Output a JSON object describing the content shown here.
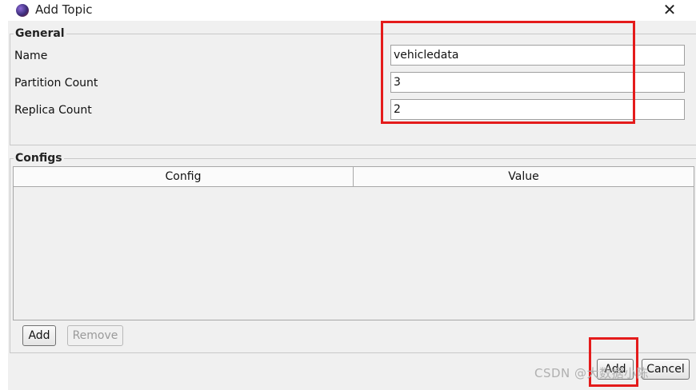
{
  "window": {
    "title": "Add Topic",
    "close_glyph": "✕",
    "icon": "app-icon"
  },
  "general": {
    "legend": "General",
    "fields": [
      {
        "label": "Name",
        "value": "vehicledata"
      },
      {
        "label": "Partition Count",
        "value": "3"
      },
      {
        "label": "Replica Count",
        "value": "2"
      }
    ]
  },
  "configs": {
    "legend": "Configs",
    "columns": [
      "Config",
      "Value"
    ],
    "rows": [],
    "add_label": "Add",
    "remove_label": "Remove"
  },
  "footer": {
    "add_label": "Add",
    "cancel_label": "Cancel"
  },
  "watermark": "CSDN @大数据小陈",
  "highlight_color": "#e41b1b"
}
